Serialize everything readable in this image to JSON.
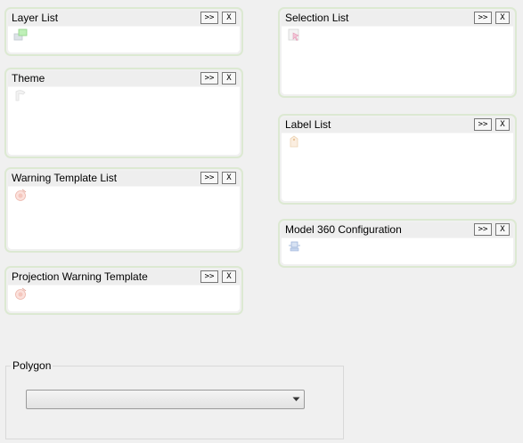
{
  "panels": {
    "layer_list": {
      "title": "Layer List",
      "expand_label": ">>",
      "close_label": "X",
      "icon": "layers-icon"
    },
    "theme": {
      "title": "Theme",
      "expand_label": ">>",
      "close_label": "X",
      "icon": "theme-icon"
    },
    "warning_template_list": {
      "title": "Warning Template List",
      "expand_label": ">>",
      "close_label": "X",
      "icon": "warning-template-icon"
    },
    "projection_warning_template": {
      "title": "Projection Warning Template",
      "expand_label": ">>",
      "close_label": "X",
      "icon": "projection-warning-icon"
    },
    "selection_list": {
      "title": "Selection List",
      "expand_label": ">>",
      "close_label": "X",
      "icon": "selection-icon"
    },
    "label_list": {
      "title": "Label List",
      "expand_label": ">>",
      "close_label": "X",
      "icon": "label-icon"
    },
    "model_360_configuration": {
      "title": "Model 360 Configuration",
      "expand_label": ">>",
      "close_label": "X",
      "icon": "model-config-icon"
    }
  },
  "polygon": {
    "label": "Polygon",
    "selected_value": ""
  }
}
